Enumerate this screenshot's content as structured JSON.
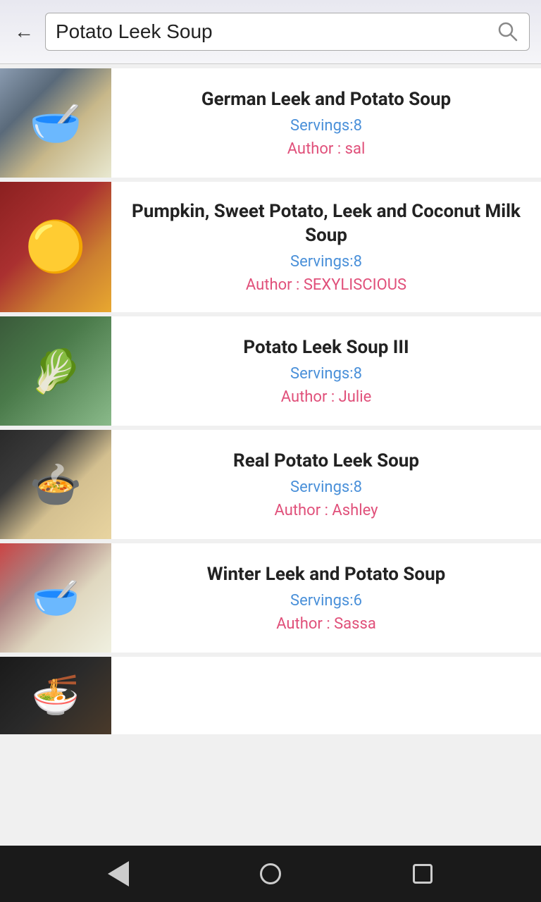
{
  "search": {
    "query": "Potato Leek Soup",
    "placeholder": "Potato Leek Soup"
  },
  "recipes": [
    {
      "id": 1,
      "title": "German Leek and Potato Soup",
      "servings_label": "Servings:8",
      "author_label": "Author : sal",
      "thumb_class": "thumb-1"
    },
    {
      "id": 2,
      "title": "Pumpkin, Sweet Potato, Leek and Coconut Milk Soup",
      "servings_label": "Servings:8",
      "author_label": "Author : SEXYLISCIOUS",
      "thumb_class": "thumb-2"
    },
    {
      "id": 3,
      "title": "Potato Leek Soup III",
      "servings_label": "Servings:8",
      "author_label": "Author : Julie",
      "thumb_class": "thumb-3"
    },
    {
      "id": 4,
      "title": "Real Potato Leek Soup",
      "servings_label": "Servings:8",
      "author_label": "Author : Ashley",
      "thumb_class": "thumb-4"
    },
    {
      "id": 5,
      "title": "Winter Leek and Potato Soup",
      "servings_label": "Servings:6",
      "author_label": "Author : Sassa",
      "thumb_class": "thumb-5"
    },
    {
      "id": 6,
      "title": "",
      "servings_label": "",
      "author_label": "",
      "thumb_class": "thumb-6",
      "partial": true
    }
  ],
  "nav": {
    "back_label": "back",
    "home_label": "home",
    "recents_label": "recents"
  }
}
